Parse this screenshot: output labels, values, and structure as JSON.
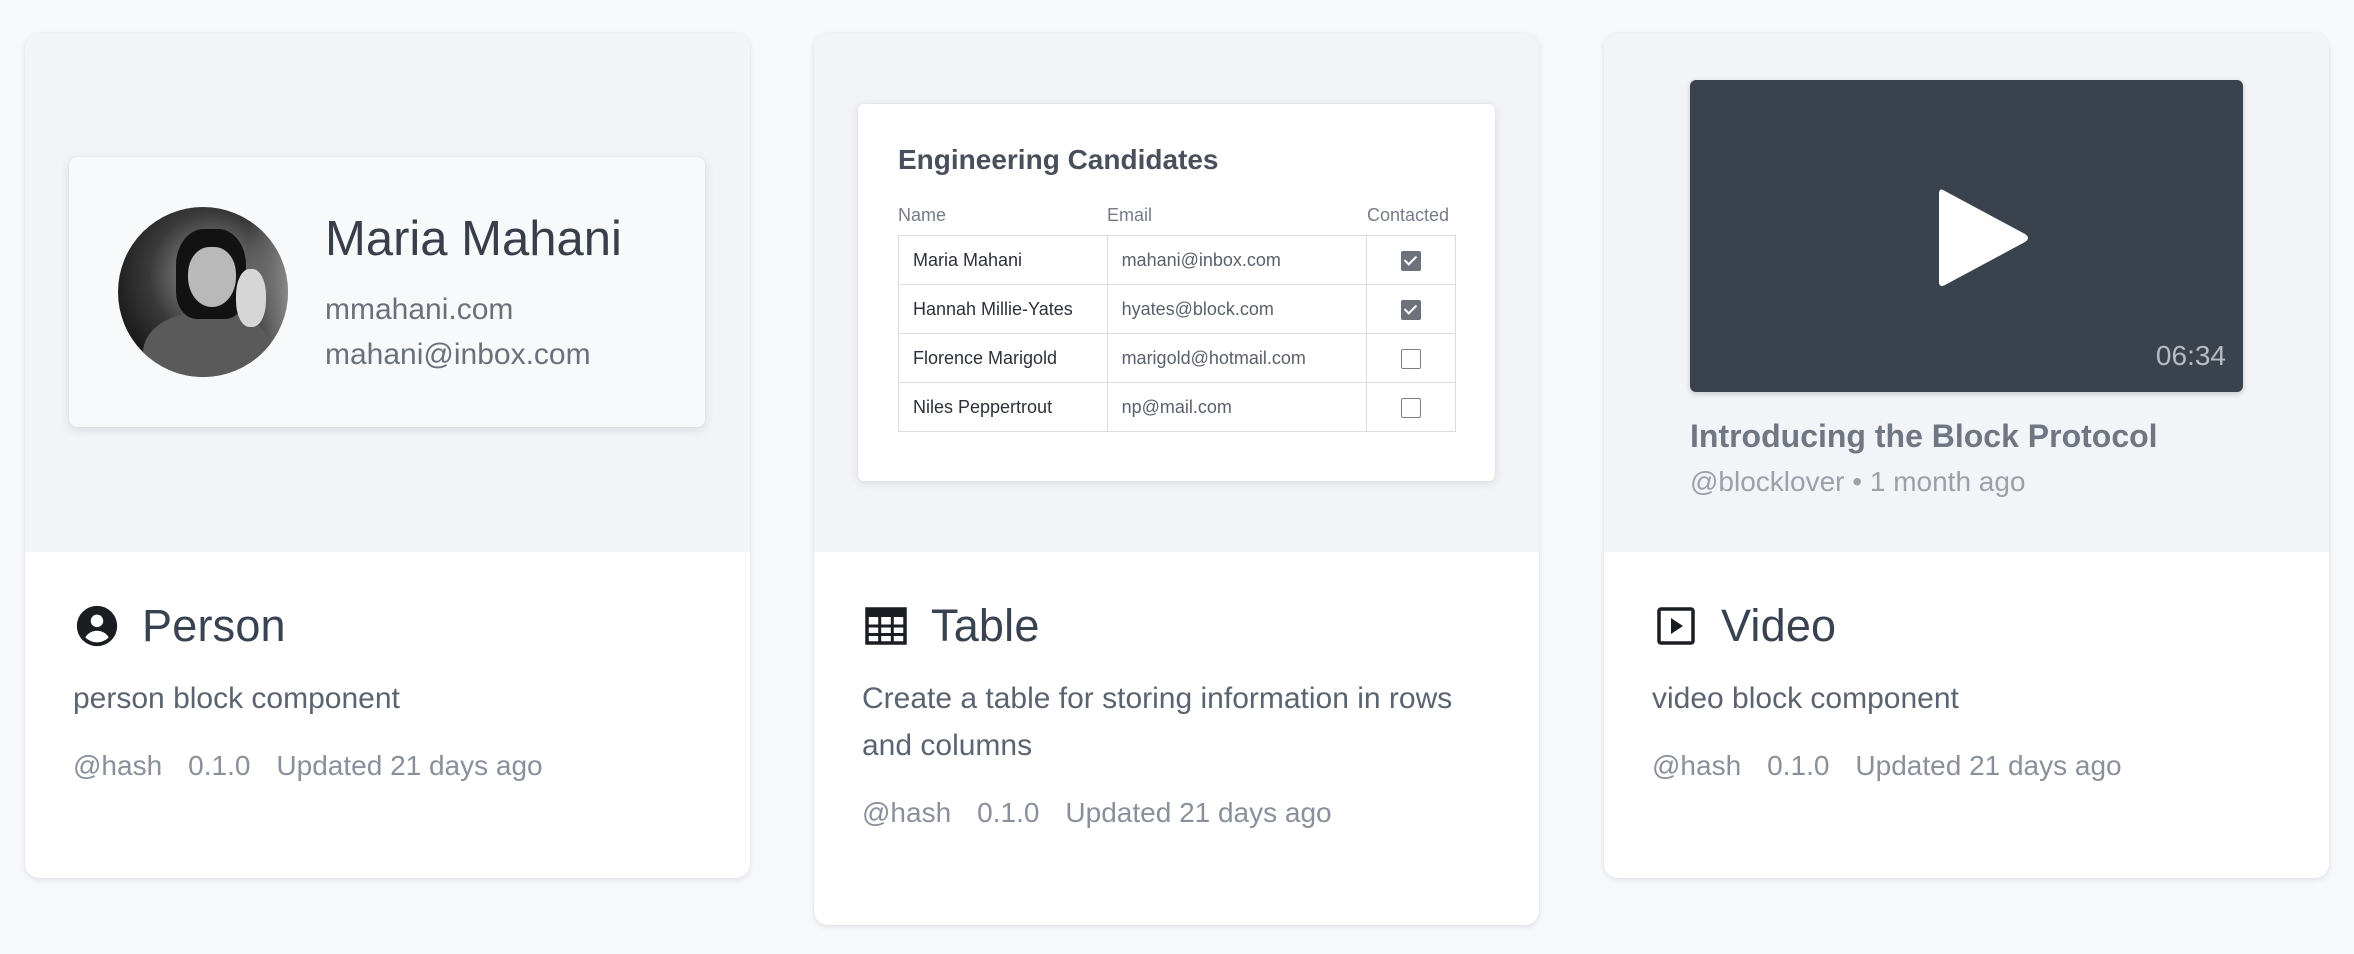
{
  "cards": [
    {
      "title": "Person",
      "icon": "person-circle-icon",
      "description": "person block component",
      "author": "@hash",
      "version": "0.1.0",
      "updated": "Updated 21 days ago",
      "preview": {
        "name": "Maria Mahani",
        "website": "mmahani.com",
        "email": "mahani@inbox.com"
      }
    },
    {
      "title": "Table",
      "icon": "table-grid-icon",
      "description": "Create a table for storing information in rows and columns",
      "author": "@hash",
      "version": "0.1.0",
      "updated": "Updated 21 days ago",
      "preview": {
        "title": "Engineering Candidates",
        "columns": [
          "Name",
          "Email",
          "Contacted"
        ],
        "rows": [
          {
            "name": "Maria Mahani",
            "email": "mahani@inbox.com",
            "contacted": true
          },
          {
            "name": "Hannah Millie-Yates",
            "email": "hyates@block.com",
            "contacted": true
          },
          {
            "name": "Florence Marigold",
            "email": "marigold@hotmail.com",
            "contacted": false
          },
          {
            "name": "Niles Peppertrout",
            "email": "np@mail.com",
            "contacted": false
          }
        ]
      }
    },
    {
      "title": "Video",
      "icon": "video-play-square-icon",
      "description": "video block component",
      "author": "@hash",
      "version": "0.1.0",
      "updated": "Updated 21 days ago",
      "preview": {
        "duration": "06:34",
        "video_title": "Introducing the Block Protocol",
        "video_meta": "@blocklover • 1 month ago"
      }
    }
  ],
  "colors": {
    "page_bg": "#f7f8fb",
    "preview_bg": "#f3f4f8",
    "video_bg": "#3a434d",
    "title_text": "#384250"
  }
}
